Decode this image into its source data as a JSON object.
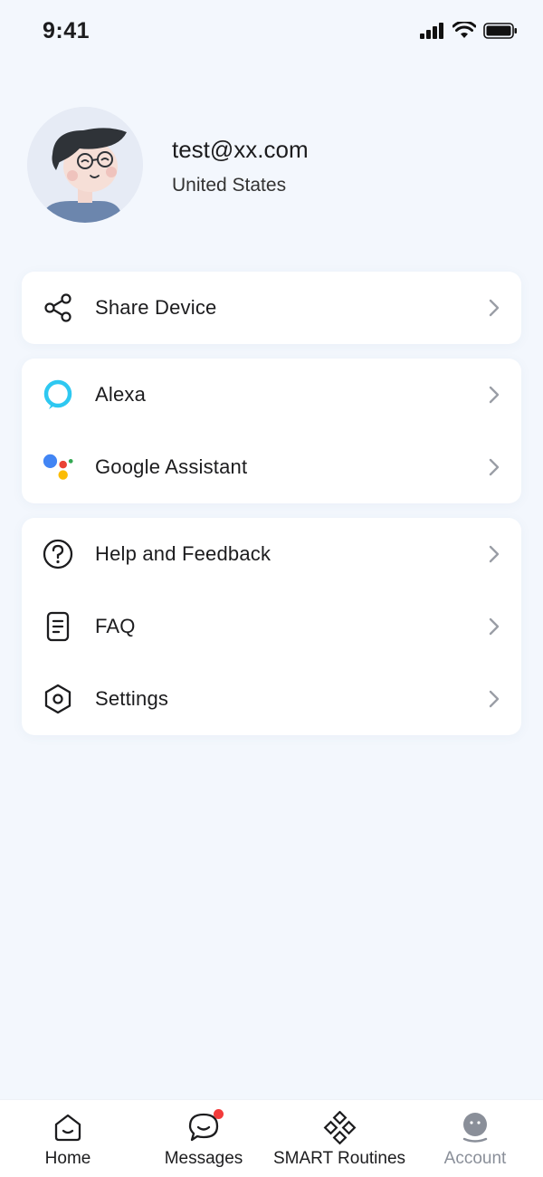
{
  "status_bar": {
    "time": "9:41"
  },
  "profile": {
    "email": "test@xx.com",
    "country": "United States"
  },
  "groups": [
    {
      "items": [
        {
          "label": "Share Device",
          "icon": "share-icon"
        }
      ]
    },
    {
      "items": [
        {
          "label": "Alexa",
          "icon": "alexa-icon"
        },
        {
          "label": "Google Assistant",
          "icon": "google-assistant-icon"
        }
      ]
    },
    {
      "items": [
        {
          "label": "Help and Feedback",
          "icon": "help-icon"
        },
        {
          "label": "FAQ",
          "icon": "faq-icon"
        },
        {
          "label": "Settings",
          "icon": "settings-icon"
        }
      ]
    }
  ],
  "tabbar": {
    "tabs": [
      {
        "label": "Home",
        "icon": "home-icon",
        "active": false
      },
      {
        "label": "Messages",
        "icon": "messages-icon",
        "active": false,
        "has_badge": true
      },
      {
        "label": "SMART Routines",
        "icon": "routines-icon",
        "active": false
      },
      {
        "label": "Account",
        "icon": "account-icon",
        "active": true
      }
    ]
  },
  "colors": {
    "background": "#f3f7fd",
    "card": "#ffffff",
    "alexa": "#2ec8f1",
    "badge": "#f33b3b",
    "inactive_tab": "#8a8f99"
  }
}
